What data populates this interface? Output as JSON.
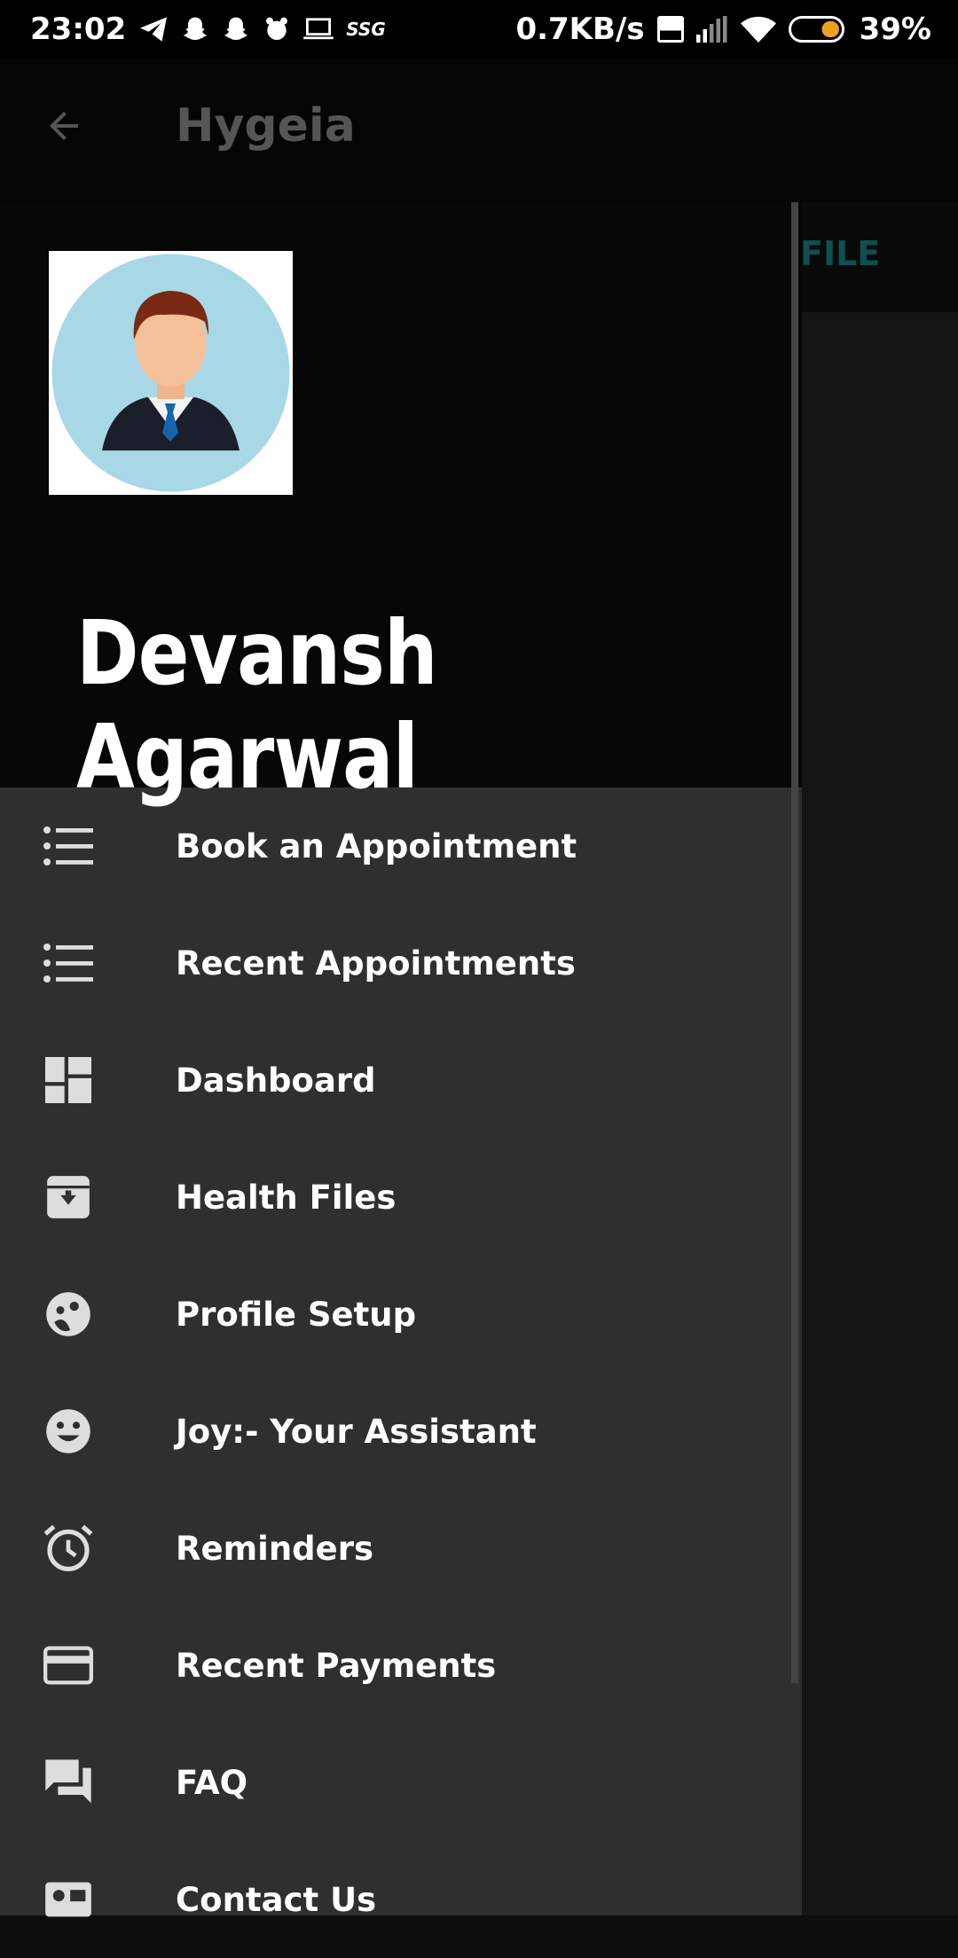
{
  "status_bar": {
    "time": "23:02",
    "ssg": "SSG",
    "speed": "0.7KB/s",
    "battery": "39%"
  },
  "app": {
    "title": "Hygeia",
    "tab_label": "FILE"
  },
  "drawer": {
    "user_name": "Devansh Agarwal",
    "items": [
      {
        "label": "Book an Appointment",
        "icon": "list-icon"
      },
      {
        "label": "Recent Appointments",
        "icon": "list-icon"
      },
      {
        "label": "Dashboard",
        "icon": "dashboard-icon"
      },
      {
        "label": "Health Files",
        "icon": "archive-icon"
      },
      {
        "label": "Profile Setup",
        "icon": "face-icon"
      },
      {
        "label": "Joy:- Your Assistant",
        "icon": "smile-icon"
      },
      {
        "label": "Reminders",
        "icon": "alarm-icon"
      },
      {
        "label": "Recent Payments",
        "icon": "credit-card-icon"
      },
      {
        "label": "FAQ",
        "icon": "forum-icon"
      },
      {
        "label": "Contact Us",
        "icon": "contact-icon"
      }
    ]
  },
  "colors": {
    "drawer_bg": "#2f2f2f",
    "header_bg": "#070707",
    "accent": "#0e4f4f"
  }
}
